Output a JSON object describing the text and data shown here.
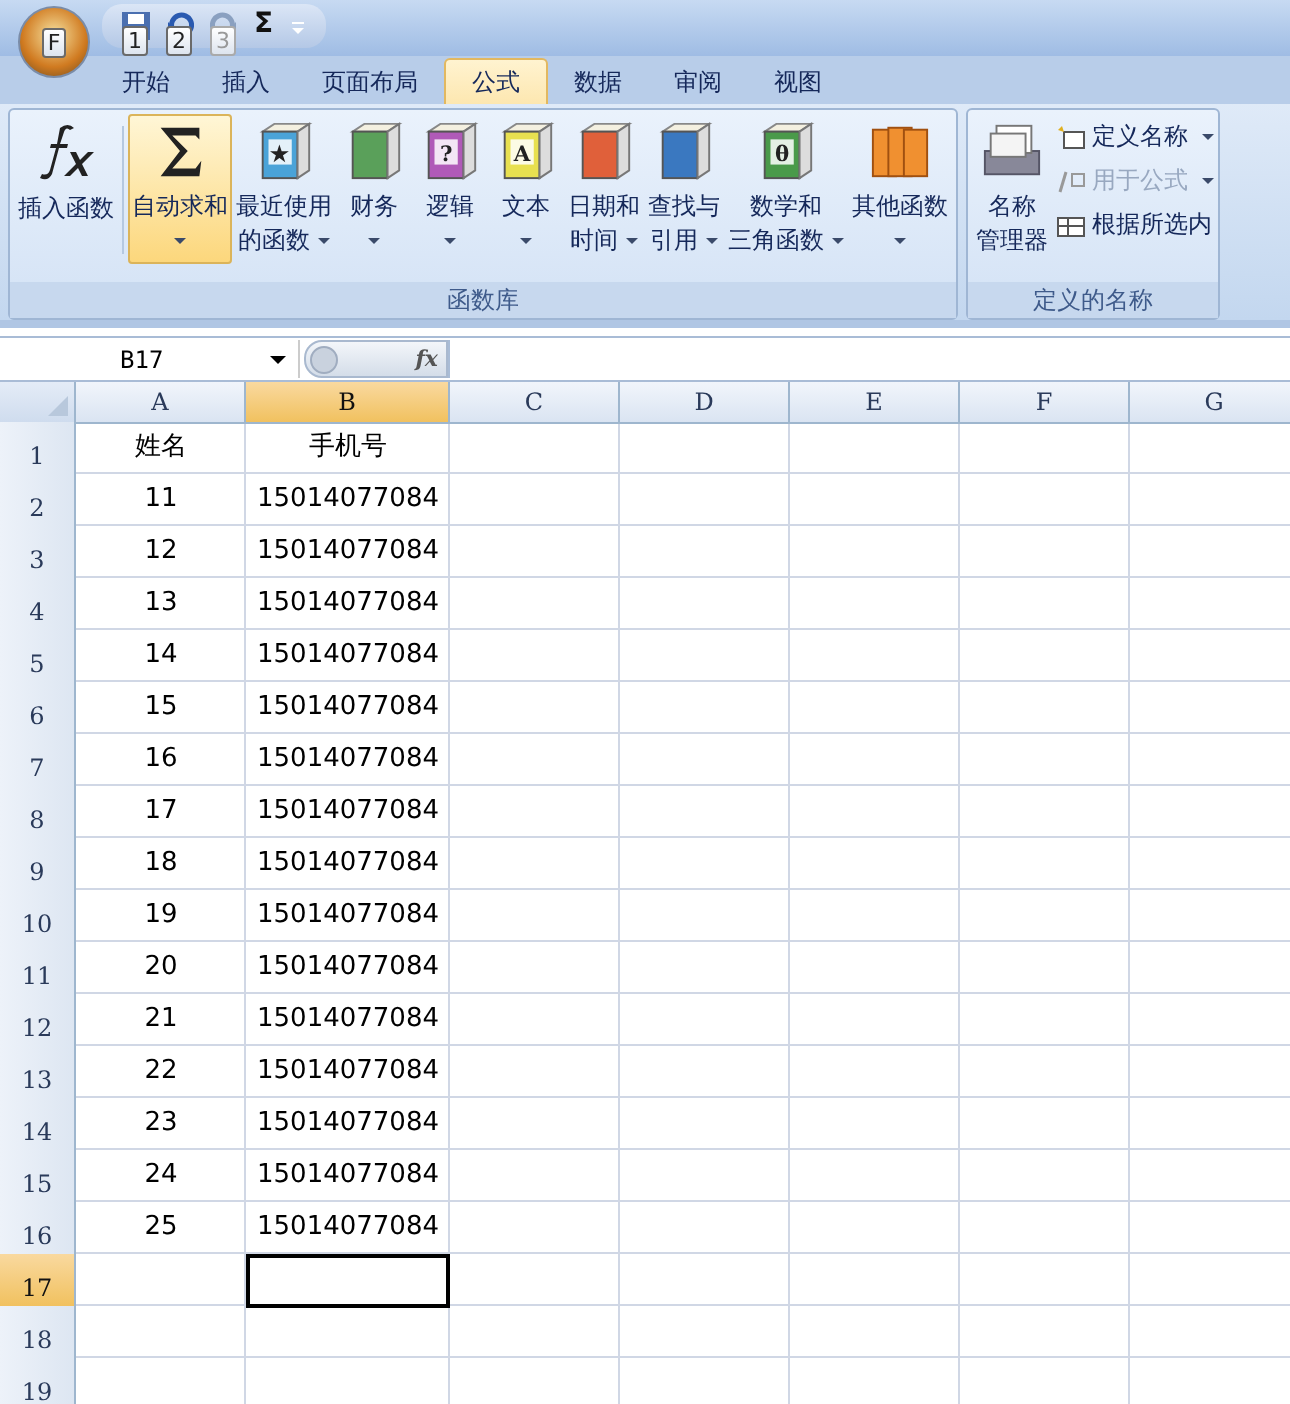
{
  "office_button": {
    "keytip": "F"
  },
  "quick_access": {
    "keytips": [
      "1",
      "2",
      "3"
    ],
    "sum_symbol": "Σ"
  },
  "tabs": [
    {
      "label": "开始",
      "selected": false
    },
    {
      "label": "插入",
      "selected": false
    },
    {
      "label": "页面布局",
      "selected": false
    },
    {
      "label": "公式",
      "selected": true
    },
    {
      "label": "数据",
      "selected": false
    },
    {
      "label": "审阅",
      "selected": false
    },
    {
      "label": "视图",
      "selected": false
    }
  ],
  "ribbon_groups": [
    {
      "title": "函数库",
      "buttons": [
        {
          "kind": "function",
          "lines": [
            "插入函数"
          ],
          "selected": false
        },
        {
          "kind": "sum",
          "lines": [
            "自动求和"
          ],
          "dropdown": true,
          "selected": true
        },
        {
          "kind": "book",
          "color": "#4aa3d8",
          "glyph": "★",
          "lines": [
            "最近使用",
            "的函数"
          ],
          "dropdown": true,
          "selected": false
        },
        {
          "kind": "book",
          "color": "#5aa05a",
          "lines": [
            "财务"
          ],
          "dropdown": true,
          "selected": false
        },
        {
          "kind": "book",
          "color": "#b05ab8",
          "glyph": "?",
          "lines": [
            "逻辑"
          ],
          "dropdown": true,
          "selected": false
        },
        {
          "kind": "book",
          "color": "#e8e050",
          "glyph": "A",
          "lines": [
            "文本"
          ],
          "dropdown": true,
          "selected": false
        },
        {
          "kind": "book",
          "color": "#e0603a",
          "lines": [
            "日期和",
            "时间"
          ],
          "dropdown": true,
          "selected": false
        },
        {
          "kind": "book",
          "color": "#3a78c0",
          "lines": [
            "查找与",
            "引用"
          ],
          "dropdown": true,
          "selected": false
        },
        {
          "kind": "book",
          "color": "#4a9a4a",
          "glyph": "θ",
          "lines": [
            "数学和",
            "三角函数"
          ],
          "dropdown": true,
          "selected": false
        },
        {
          "kind": "books",
          "color": "#f09030",
          "lines": [
            "其他函数"
          ],
          "dropdown": true,
          "selected": false
        }
      ]
    },
    {
      "title": "定义的名称",
      "big": {
        "lines": [
          "名称",
          "管理器"
        ]
      },
      "small": [
        {
          "label": "定义名称",
          "dropdown": true,
          "disabled": false
        },
        {
          "label": "用于公式",
          "dropdown": true,
          "disabled": true
        },
        {
          "label": "根据所选内",
          "disabled": false
        }
      ]
    }
  ],
  "name_box": "B17",
  "formula_label": "fx",
  "columns": [
    {
      "label": "A",
      "selected": false
    },
    {
      "label": "B",
      "selected": true
    },
    {
      "label": "C",
      "selected": false
    },
    {
      "label": "D",
      "selected": false
    },
    {
      "label": "E",
      "selected": false
    },
    {
      "label": "F",
      "selected": false
    },
    {
      "label": "G",
      "selected": false
    }
  ],
  "rows": [
    {
      "label": "1",
      "selected": false,
      "cells": [
        "姓名",
        "手机号"
      ]
    },
    {
      "label": "2",
      "selected": false,
      "cells": [
        "11",
        "15014077084"
      ]
    },
    {
      "label": "3",
      "selected": false,
      "cells": [
        "12",
        "15014077084"
      ]
    },
    {
      "label": "4",
      "selected": false,
      "cells": [
        "13",
        "15014077084"
      ]
    },
    {
      "label": "5",
      "selected": false,
      "cells": [
        "14",
        "15014077084"
      ]
    },
    {
      "label": "6",
      "selected": false,
      "cells": [
        "15",
        "15014077084"
      ]
    },
    {
      "label": "7",
      "selected": false,
      "cells": [
        "16",
        "15014077084"
      ]
    },
    {
      "label": "8",
      "selected": false,
      "cells": [
        "17",
        "15014077084"
      ]
    },
    {
      "label": "9",
      "selected": false,
      "cells": [
        "18",
        "15014077084"
      ]
    },
    {
      "label": "10",
      "selected": false,
      "cells": [
        "19",
        "15014077084"
      ]
    },
    {
      "label": "11",
      "selected": false,
      "cells": [
        "20",
        "15014077084"
      ]
    },
    {
      "label": "12",
      "selected": false,
      "cells": [
        "21",
        "15014077084"
      ]
    },
    {
      "label": "13",
      "selected": false,
      "cells": [
        "22",
        "15014077084"
      ]
    },
    {
      "label": "14",
      "selected": false,
      "cells": [
        "23",
        "15014077084"
      ]
    },
    {
      "label": "15",
      "selected": false,
      "cells": [
        "24",
        "15014077084"
      ]
    },
    {
      "label": "16",
      "selected": false,
      "cells": [
        "25",
        "15014077084"
      ]
    },
    {
      "label": "17",
      "selected": true
    },
    {
      "label": "18",
      "selected": false
    },
    {
      "label": "19",
      "selected": false
    }
  ]
}
